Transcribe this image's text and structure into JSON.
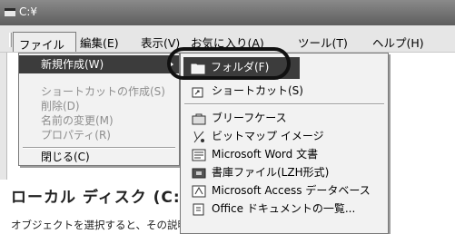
{
  "window": {
    "title": "C:¥"
  },
  "menubar": {
    "items": [
      {
        "label": "ファイル(F)"
      },
      {
        "label": "編集(E)"
      },
      {
        "label": "表示(V)"
      },
      {
        "label": "お気に入り(A)"
      },
      {
        "label": "ツール(T)"
      },
      {
        "label": "ヘルプ(H)"
      }
    ]
  },
  "file_menu": {
    "new": "新規作成(W)",
    "create_shortcut": "ショートカットの作成(S)",
    "delete": "削除(D)",
    "rename": "名前の変更(M)",
    "properties": "プロパティ(R)",
    "close": "閉じる(C)"
  },
  "new_submenu": {
    "folder": "フォルダ(F)",
    "shortcut": "ショートカット(S)",
    "briefcase": "ブリーフケース",
    "bitmap": "ビットマップ イメージ",
    "word": "Microsoft Word 文書",
    "lzh": "書庫ファイル(LZH形式)",
    "access": "Microsoft Access データベース",
    "office_list": "Office ドキュメントの一覧..."
  },
  "explorer": {
    "heading": "ローカル ディスク (C:)",
    "hint": "オブジェクトを選択すると、その説明が表示されます。"
  }
}
